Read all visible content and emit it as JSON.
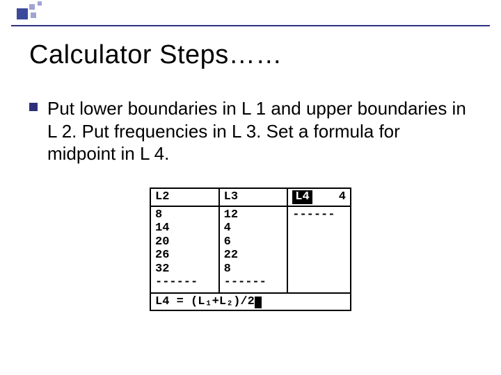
{
  "title": "Calculator Steps……",
  "bullet": "Put lower boundaries in L 1 and upper boundaries in L 2.  Put frequencies in L 3.  Set a formula for midpoint in L 4.",
  "calc": {
    "headers": {
      "c1": "L2",
      "c2": "L3",
      "c3_label": "L4",
      "c3_right": "4"
    },
    "col1": [
      "8",
      "14",
      "20",
      "26",
      "32",
      "------"
    ],
    "col2": [
      "12",
      "4",
      "6",
      "22",
      "8",
      "------"
    ],
    "col3": [
      "------"
    ],
    "formula_prefix": "L4 =",
    "formula_body": "(L₁+L₂)/2"
  }
}
